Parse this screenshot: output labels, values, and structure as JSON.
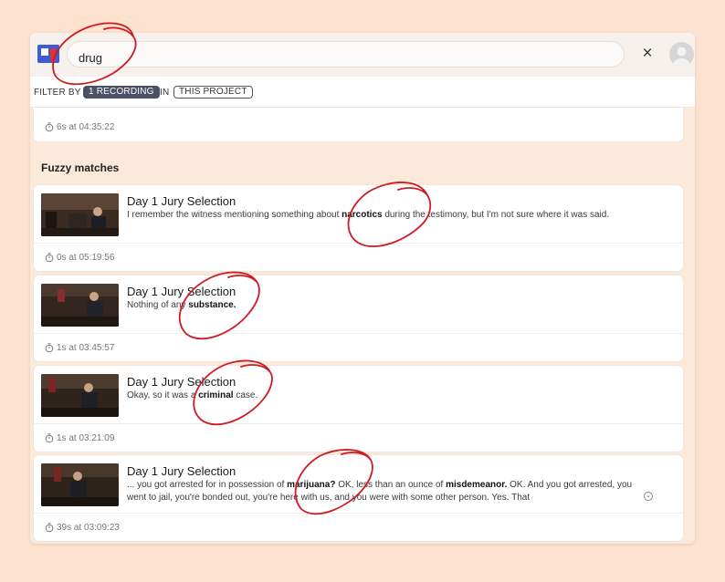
{
  "search": {
    "value": "drug"
  },
  "close_icon": "×",
  "filter": {
    "label_before": "FILTER BY",
    "recording_chip": "1 RECORDING",
    "label_mid": "IN",
    "project_chip": "THIS PROJECT"
  },
  "first_result": {
    "time": "6s at 04:35:22"
  },
  "section_title": "Fuzzy matches",
  "results": [
    {
      "title": "Day 1 Jury Selection",
      "snippet_before": "I remember the witness mentioning something about ",
      "highlight": "narcotics",
      "snippet_after": " during the testimony, but I'm not sure where it was said.",
      "time": "0s at 05:19:56"
    },
    {
      "title": "Day 1 Jury Selection",
      "snippet_before": "Nothing of any ",
      "highlight": "substance.",
      "snippet_after": "",
      "time": "1s at 03:45:57"
    },
    {
      "title": "Day 1 Jury Selection",
      "snippet_before": "Okay, so it was a ",
      "highlight": "criminal",
      "snippet_after": " case.",
      "time": "1s at 03:21:09"
    },
    {
      "title": "Day 1 Jury Selection",
      "snippet_before": "... you got arrested for in possession of ",
      "highlight": "marijuana?",
      "snippet_mid": " OK, less than an ounce of ",
      "highlight2": "misdemeanor.",
      "snippet_after": " OK. And you got arrested, you went to jail, you're bonded out, you're here with us, and you were with some other person. Yes. That",
      "time": "39s at 03:09:23"
    }
  ],
  "colors": {
    "background": "#fde3cf",
    "chip_dark": "#4b5066",
    "annotation_red": "#d01a22"
  },
  "icons": [
    "app-logo-icon",
    "close-icon",
    "avatar-icon",
    "timer-icon",
    "expand-chevron-icon"
  ]
}
